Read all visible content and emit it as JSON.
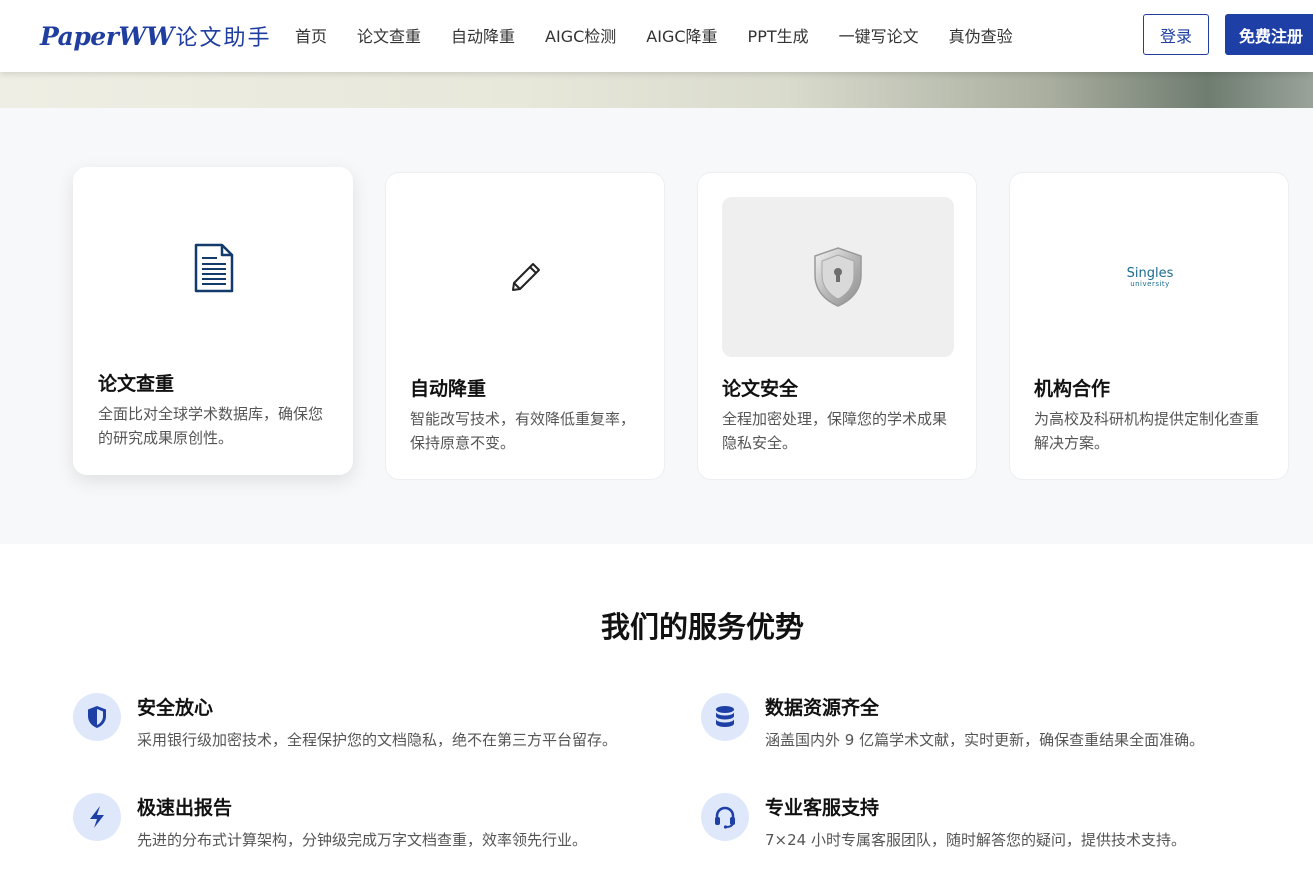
{
  "header": {
    "logo_script": "PaperWW",
    "logo_cn": "论文助手",
    "nav": [
      "首页",
      "论文查重",
      "自动降重",
      "AIGC检测",
      "AIGC降重",
      "PPT生成",
      "一键写论文",
      "真伪查验"
    ],
    "login_label": "登录",
    "register_label": "免费注册"
  },
  "colors": {
    "brand": "#1e3fa6",
    "icon_bg": "#dfe8fb"
  },
  "cards": [
    {
      "title": "论文查重",
      "desc": "全面比对全球学术数据库，确保您的研究成果原创性。",
      "icon": "document-icon"
    },
    {
      "title": "自动降重",
      "desc": "智能改写技术，有效降低重复率，保持原意不变。",
      "icon": "pencil-icon"
    },
    {
      "title": "论文安全",
      "desc": "全程加密处理，保障您的学术成果隐私安全。",
      "icon": "shield-lock-image"
    },
    {
      "title": "机构合作",
      "desc": "为高校及科研机构提供定制化查重解决方案。",
      "icon": "singles-university-logo",
      "logo_line1": "Singles",
      "logo_line2": "university"
    }
  ],
  "advantages": {
    "title": "我们的服务优势",
    "items": [
      {
        "name": "安全放心",
        "desc": "采用银行级加密技术，全程保护您的文档隐私，绝不在第三方平台留存。",
        "icon": "shield-icon"
      },
      {
        "name": "数据资源齐全",
        "desc": "涵盖国内外 9 亿篇学术文献，实时更新，确保查重结果全面准确。",
        "icon": "database-icon"
      },
      {
        "name": "极速出报告",
        "desc": "先进的分布式计算架构，分钟级完成万字文档查重，效率领先行业。",
        "icon": "lightning-icon"
      },
      {
        "name": "专业客服支持",
        "desc": "7×24 小时专属客服团队，随时解答您的疑问，提供技术支持。",
        "icon": "headset-icon"
      }
    ]
  }
}
